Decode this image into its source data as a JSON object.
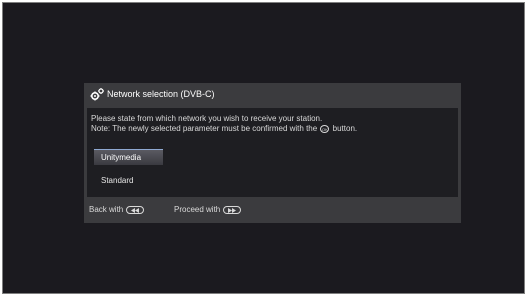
{
  "dialog": {
    "title": "Network selection (DVB-C)",
    "message_line1": "Please state from which network you wish to receive your station.",
    "message_line2_before": "Note: The newly selected parameter must be confirmed with the",
    "ok_symbol": "OK",
    "message_line2_after": "button.",
    "options": [
      {
        "label": "Unitymedia",
        "selected": true
      },
      {
        "label": "Standard",
        "selected": false
      }
    ]
  },
  "footer": {
    "back_label": "Back with",
    "proceed_label": "Proceed with"
  },
  "colors": {
    "screen_background": "#1b1a1f",
    "dialog_panel": "#3b3b3e",
    "dialog_body": "#1e1e22",
    "selection_accent": "#8fa9d2"
  },
  "icons": {
    "header": "gears-icon",
    "back": "rewind-button-icon",
    "proceed": "fast-forward-button-icon"
  }
}
